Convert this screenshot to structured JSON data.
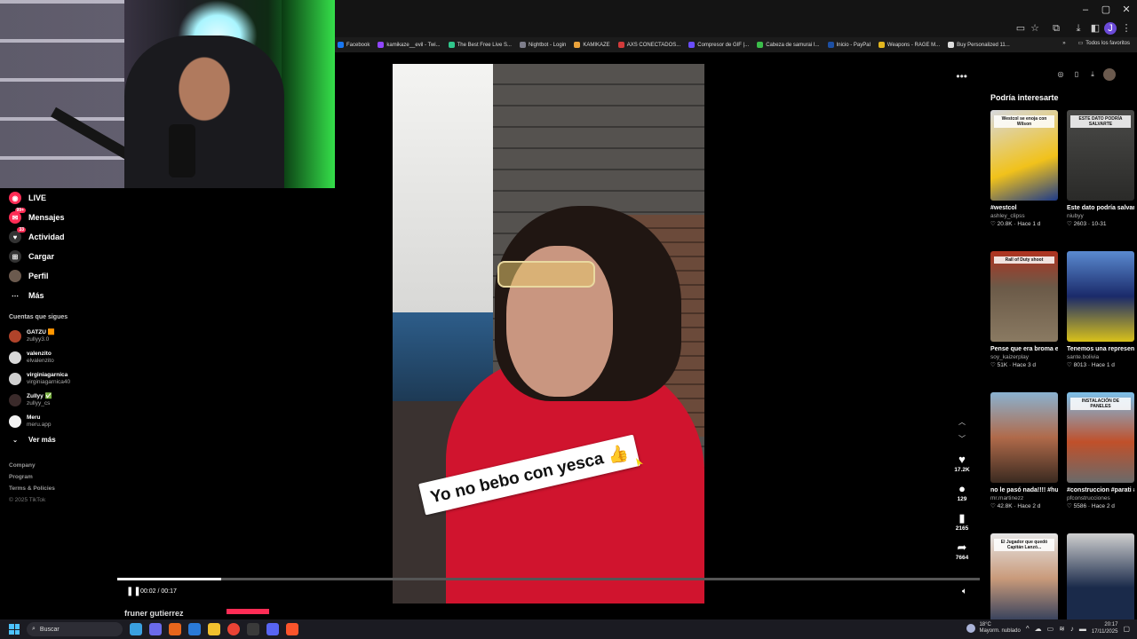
{
  "browser": {
    "window_controls": [
      "–",
      "▢",
      "✕"
    ],
    "bookmarks": [
      {
        "label": "Facebook",
        "color": "#1877f2"
      },
      {
        "label": "kamikaze__evil - Twi...",
        "color": "#9146ff"
      },
      {
        "label": "The Best Free Live S...",
        "color": "#30c78c"
      },
      {
        "label": "Nightbot - Login",
        "color": "#7d7d8a"
      },
      {
        "label": "KAMIKAZE",
        "color": "#e9a23b"
      },
      {
        "label": "AXS CONECTADOS...",
        "color": "#d23a3a"
      },
      {
        "label": "Compresor de GIF |...",
        "color": "#6a4dfc"
      },
      {
        "label": "Cabeza de samurai I...",
        "color": "#3bbd4a"
      },
      {
        "label": "Inicio - PayPal",
        "color": "#1c4fa3"
      },
      {
        "label": "Weapons - RAGE M...",
        "color": "#e2b61e"
      },
      {
        "label": "Buy Personalized 11...",
        "color": "#dddddd"
      }
    ],
    "bookmarks_more": "»",
    "favorites_label": "Todos los favoritos"
  },
  "sidebar": {
    "nav": [
      {
        "label": "LIVE",
        "icon": "live-icon",
        "color": "#fe2c55"
      },
      {
        "label": "Mensajes",
        "icon": "messages-icon",
        "color": "#fe2c55",
        "badge": "99+"
      },
      {
        "label": "Actividad",
        "icon": "activity-icon",
        "color": "#333",
        "badge": "33"
      },
      {
        "label": "Cargar",
        "icon": "upload-icon",
        "color": "#333"
      },
      {
        "label": "Perfil",
        "icon": "profile-icon",
        "color": "#6b5a4e"
      },
      {
        "label": "Más",
        "icon": "more-icon",
        "color": "#000"
      }
    ],
    "following_title": "Cuentas que sigues",
    "following": [
      {
        "name": "GATZU 🟧",
        "user": "zullyy3.0"
      },
      {
        "name": "valenzito",
        "user": "elvalenzito"
      },
      {
        "name": "virginiagarnica",
        "user": "virginiagarnica40"
      },
      {
        "name": "Zullyy ✅",
        "user": "zullyy_cs"
      },
      {
        "name": "Meru",
        "user": "meru.app"
      }
    ],
    "see_more": "Ver más",
    "footer": [
      "Company",
      "Program",
      "Terms & Policies"
    ],
    "copyright": "© 2025 TikTok"
  },
  "video": {
    "caption": "Yo no bebo con yesca 👍",
    "likes": "17.2K",
    "comments": "129",
    "saves": "2165",
    "shares": "7664",
    "time": "00:02 / 00:17",
    "progress": 0.12,
    "next_author": "fruner gutierrez"
  },
  "right_panel": {
    "title": "Podría interesarte",
    "cards": [
      {
        "title": "#westcol",
        "user": "ashley_clipss",
        "meta": "♡ 20.8K · Hace 1 d",
        "thumb_text": "Westcol se enoja con Wilson",
        "bg": "linear-gradient(160deg,#d7d9df,#f1c21b 60%,#1d3a8a)"
      },
      {
        "title": "Este dato podría salvarte la partida ...",
        "user": "niubyy",
        "meta": "♡ 2603 · 10-31",
        "thumb_text": "ESTE DATO PODRÍA SALVARTE",
        "bg": "linear-gradient(180deg,#4a4a48,#2a2a28)"
      },
      {
        "title": "Pense que era broma esto. COD ha...",
        "user": "soy_kaizerplay",
        "meta": "♡ 51K · Hace 3 d",
        "thumb_text": "Rall of Duty shoot",
        "bg": "linear-gradient(180deg,#b0321f,#6b5a48 40%,#8a7a62)"
      },
      {
        "title": "Tenemos una representante de la...",
        "user": "sante.bolivia",
        "meta": "♡ 8013 · Hace 1 d",
        "thumb_text": "",
        "bg": "linear-gradient(180deg,#5a8ad0,#1a2a6a 50%,#d9c21a)"
      },
      {
        "title": "no le pasó nada!!!! #humorbiker...",
        "user": "mr.martinezz",
        "meta": "♡ 42.8K · Hace 2 d",
        "thumb_text": "",
        "bg": "linear-gradient(180deg,#8ab2d0,#b06a4a 50%,#3a2a20)"
      },
      {
        "title": "#construccion #parati #isopanel",
        "user": "pfconstrucciones",
        "meta": "♡ 5586 · Hace 2 d",
        "thumb_text": "INSTALACIÓN DE PANELES",
        "bg": "linear-gradient(180deg,#7cc0ea,#c0502a 55%,#6a6a6a)"
      },
      {
        "title": "",
        "user": "",
        "meta": "",
        "thumb_text": "El Jugador que quedó Capitán Lanzó...",
        "bg": "linear-gradient(180deg,#e6e6e6,#c99a7a 50%,#2a3a5a)"
      },
      {
        "title": "",
        "user": "",
        "meta": "",
        "thumb_text": "",
        "bg": "linear-gradient(180deg,#cfcfcf,#1a2a4a 60%)"
      }
    ]
  },
  "taskbar": {
    "search": "Buscar",
    "apps": [
      "#3aa0e0",
      "#6a6aea",
      "#e8661c",
      "#2a7ad8",
      "#f2c12e",
      "#ea4335",
      "#3a3a3a",
      "#5865f2",
      "#fb542b"
    ],
    "weather_temp": "18°C",
    "weather_desc": "Mayorm. nublado",
    "time": "20:17",
    "date": "17/11/2025"
  }
}
